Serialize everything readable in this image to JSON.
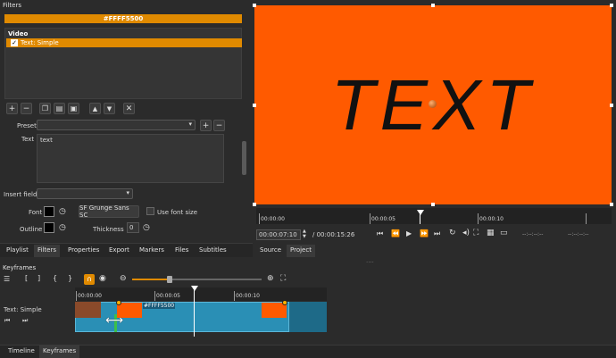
{
  "filters": {
    "panel_title": "Filters",
    "color_bar": "#FFFF5500",
    "section": "Video",
    "items": [
      {
        "label": "Text: Simple",
        "checked": true
      }
    ],
    "preset_label": "Preset",
    "text_label": "Text",
    "text_value": "text",
    "insert_field_label": "Insert field",
    "font_label": "Font",
    "font_name": "SF Grunge Sans SC",
    "use_font_size": "Use font size",
    "outline_label": "Outline",
    "thickness_label": "Thickness",
    "thickness_value": "0"
  },
  "tabs": [
    "Playlist",
    "Filters",
    "Properties",
    "Export",
    "Markers",
    "Files",
    "Subtitles"
  ],
  "preview": {
    "text": "TEXT",
    "bg_color": "#ff5a00",
    "ruler": [
      "00:00:00",
      "00:00:05",
      "00:00:10"
    ],
    "timecode": "00:00:07:10",
    "duration": "00:00:15:26",
    "in_point": "--:--:--:--",
    "out_point": "--:--:--:--",
    "tabs": [
      "Source",
      "Project"
    ]
  },
  "keyframes": {
    "panel_title": "Keyframes",
    "track_label": "Text: Simple",
    "ruler": [
      "00:00:00",
      "00:00:05",
      "00:00:10"
    ],
    "clip_label": "#FFFF5500"
  },
  "bottom_tabs": [
    "Timeline",
    "Keyframes"
  ],
  "colors": {
    "accent": "#e08a00",
    "clip": "#2a8fb5",
    "orange": "#ff5a00"
  }
}
